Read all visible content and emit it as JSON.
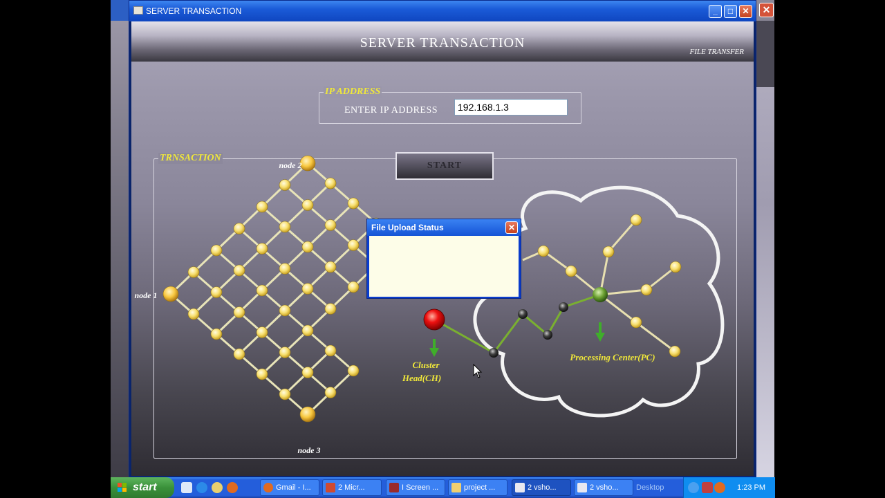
{
  "window": {
    "title": "SERVER TRANSACTION"
  },
  "header": {
    "title": "SERVER TRANSACTION",
    "subtitle": "FILE TRANSFER"
  },
  "ip_group": {
    "legend": "IP ADDRESS",
    "label": "ENTER IP ADDRESS",
    "value": "192.168.1.3"
  },
  "transaction": {
    "legend": "TRNSACTION",
    "start_label": "START"
  },
  "network": {
    "node_labels": {
      "node1": "node 1",
      "node2": "node 2",
      "node3": "node 3"
    },
    "cluster_head": [
      "Cluster",
      "Head(CH)"
    ],
    "processing_center": "Processing Center(PC)"
  },
  "dialog": {
    "title": "File Upload Status",
    "close": "✕"
  },
  "taskbar": {
    "start": "start",
    "tasks": [
      "Gmail - I...",
      "2 Micr...",
      "I Screen ...",
      "project ...",
      "2 vsho...",
      "2 vsho..."
    ],
    "desktop": "Desktop",
    "clock": "1:23 PM"
  },
  "colors": {
    "accent_yellow": "#f0e83a",
    "node_fill": "#f8e070",
    "cluster_red": "#e00000",
    "arrow_green": "#3fae2a"
  }
}
